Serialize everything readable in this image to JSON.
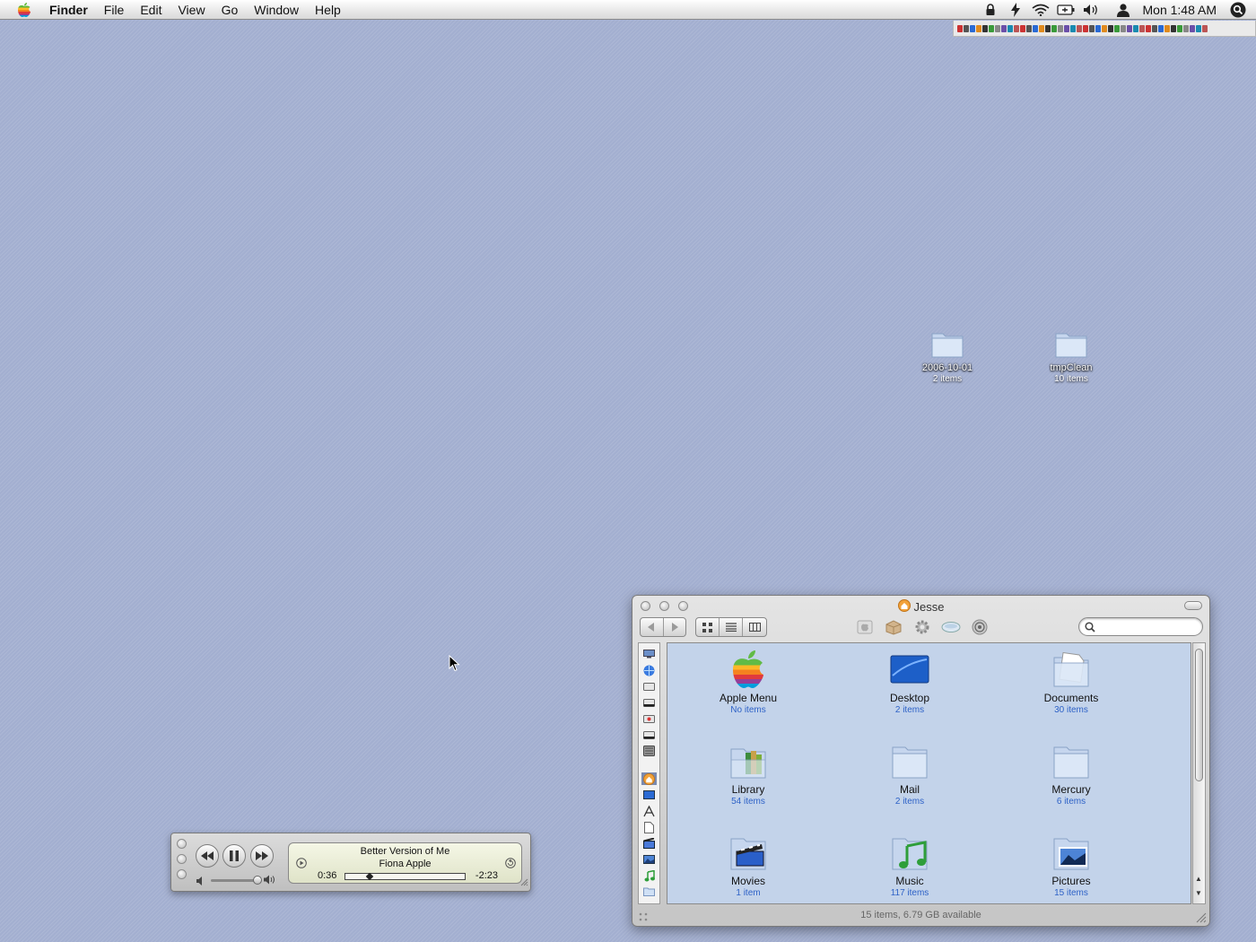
{
  "menubar": {
    "apple_icon": "apple-logo",
    "app_name": "Finder",
    "menus": [
      "File",
      "Edit",
      "View",
      "Go",
      "Window",
      "Help"
    ],
    "clock": "Mon 1:48 AM",
    "status_icons": [
      "lock-icon",
      "bolt-icon",
      "wifi-icon",
      "battery-icon",
      "volume-icon",
      "user-icon",
      "spotlight-icon"
    ]
  },
  "desktop": {
    "icons": [
      {
        "name": "2006-10-01",
        "info": "2 items"
      },
      {
        "name": "tmpClean",
        "info": "10 items"
      }
    ]
  },
  "itunes": {
    "song": "Better Version of Me",
    "artist": "Fiona Apple",
    "elapsed": "0:36",
    "remaining": "-2:23",
    "progress_fraction": 0.2,
    "volume_fraction": 1.0,
    "state": "playing"
  },
  "finder": {
    "title": "Jesse",
    "search": {
      "value": "",
      "placeholder": ""
    },
    "items": [
      {
        "name": "Apple Menu",
        "info": "No items",
        "icon": "apple-menu-icon"
      },
      {
        "name": "Desktop",
        "info": "2 items",
        "icon": "desktop-folder-icon"
      },
      {
        "name": "Documents",
        "info": "30 items",
        "icon": "documents-folder-icon"
      },
      {
        "name": "Library",
        "info": "54 items",
        "icon": "library-folder-icon"
      },
      {
        "name": "Mail",
        "info": "2 items",
        "icon": "folder-icon"
      },
      {
        "name": "Mercury",
        "info": "6 items",
        "icon": "folder-icon"
      },
      {
        "name": "Movies",
        "info": "1 item",
        "icon": "movies-folder-icon"
      },
      {
        "name": "Music",
        "info": "117 items",
        "icon": "music-folder-icon"
      },
      {
        "name": "Pictures",
        "info": "15 items",
        "icon": "pictures-folder-icon"
      }
    ],
    "status": "15 items, 6.79 GB available"
  },
  "colors": {
    "desktop_bg": "#a3afd0",
    "finder_content_bg": "#c3d3ea",
    "item_count_blue": "#2e62c7"
  }
}
